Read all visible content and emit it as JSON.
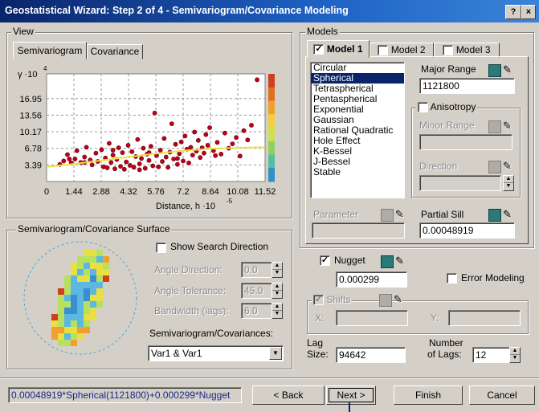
{
  "window": {
    "title": "Geostatistical Wizard: Step 2 of 4 - Semivariogram/Covariance Modeling",
    "help_label": "?",
    "close_label": "×"
  },
  "view": {
    "group_label": "View",
    "tabs": [
      "Semivariogram",
      "Covariance"
    ],
    "active_tab": "Semivariogram",
    "chart_data": {
      "type": "scatter",
      "ylabel": "γ ·10",
      "ylabel_exp": "4",
      "xlabel": "Distance, h ·10",
      "xlabel_exp": "-5",
      "ylim": [
        0,
        22
      ],
      "xlim": [
        0,
        11.52
      ],
      "yticks": [
        "3.39",
        "6.78",
        "10.17",
        "13.56",
        "16.95"
      ],
      "ytick_values": [
        3.39,
        6.78,
        10.17,
        13.56,
        16.95
      ],
      "xticks": [
        "0",
        "1.44",
        "2.88",
        "4.32",
        "5.76",
        "7.2",
        "8.64",
        "10.08",
        "11.52"
      ],
      "xtick_values": [
        0,
        1.44,
        2.88,
        4.32,
        5.76,
        7.2,
        8.64,
        10.08,
        11.52
      ],
      "grid": true,
      "fit_line": {
        "x": [
          0,
          1.44,
          2.88,
          4.32,
          5.76,
          7.2,
          8.64,
          10.08,
          11.52
        ],
        "y": [
          3.0,
          3.6,
          4.3,
          5.0,
          5.7,
          6.3,
          6.7,
          6.9,
          7.0
        ]
      },
      "points": [
        [
          0.7,
          3.5
        ],
        [
          0.9,
          4.2
        ],
        [
          1.1,
          5.5
        ],
        [
          1.3,
          3.8
        ],
        [
          1.5,
          4.6
        ],
        [
          1.6,
          6.3
        ],
        [
          1.8,
          3.9
        ],
        [
          2.0,
          5.0
        ],
        [
          2.1,
          7.0
        ],
        [
          2.3,
          4.4
        ],
        [
          2.4,
          3.4
        ],
        [
          2.6,
          5.8
        ],
        [
          2.7,
          4.1
        ],
        [
          2.9,
          6.5
        ],
        [
          3.0,
          3.0
        ],
        [
          3.1,
          4.8
        ],
        [
          3.2,
          2.8
        ],
        [
          3.3,
          7.8
        ],
        [
          3.4,
          3.9
        ],
        [
          3.5,
          5.4
        ],
        [
          3.6,
          2.6
        ],
        [
          3.7,
          4.5
        ],
        [
          3.8,
          6.9
        ],
        [
          3.9,
          3.1
        ],
        [
          4.0,
          5.9
        ],
        [
          4.1,
          2.5
        ],
        [
          4.2,
          4.0
        ],
        [
          4.3,
          7.4
        ],
        [
          4.4,
          3.3
        ],
        [
          4.5,
          6.1
        ],
        [
          4.6,
          2.9
        ],
        [
          4.7,
          5.1
        ],
        [
          4.8,
          8.6
        ],
        [
          4.9,
          3.6
        ],
        [
          5.0,
          4.7
        ],
        [
          5.1,
          6.8
        ],
        [
          5.2,
          2.7
        ],
        [
          5.3,
          5.6
        ],
        [
          5.4,
          4.3
        ],
        [
          5.5,
          7.2
        ],
        [
          5.6,
          3.2
        ],
        [
          5.7,
          14.0
        ],
        [
          5.8,
          5.3
        ],
        [
          5.9,
          3.0
        ],
        [
          6.0,
          6.4
        ],
        [
          6.1,
          4.1
        ],
        [
          6.2,
          8.8
        ],
        [
          6.3,
          5.0
        ],
        [
          6.4,
          2.9
        ],
        [
          6.5,
          6.0
        ],
        [
          6.6,
          11.8
        ],
        [
          6.7,
          4.6
        ],
        [
          6.8,
          7.6
        ],
        [
          6.9,
          3.5
        ],
        [
          7.0,
          5.7
        ],
        [
          7.1,
          8.1
        ],
        [
          7.2,
          4.2
        ],
        [
          7.3,
          9.3
        ],
        [
          7.4,
          6.6
        ],
        [
          7.5,
          3.8
        ],
        [
          7.6,
          7.0
        ],
        [
          7.7,
          5.4
        ],
        [
          7.8,
          10.1
        ],
        [
          7.9,
          6.2
        ],
        [
          8.0,
          8.4
        ],
        [
          8.1,
          4.9
        ],
        [
          8.2,
          6.9
        ],
        [
          8.3,
          5.8
        ],
        [
          8.4,
          9.6
        ],
        [
          8.5,
          7.4
        ],
        [
          8.6,
          11.0
        ],
        [
          8.8,
          6.3
        ],
        [
          9.0,
          8.0
        ],
        [
          9.2,
          5.6
        ],
        [
          9.4,
          9.9
        ],
        [
          9.6,
          6.8
        ],
        [
          9.8,
          7.7
        ],
        [
          10.0,
          9.0
        ],
        [
          10.2,
          5.2
        ],
        [
          10.4,
          10.4
        ],
        [
          10.6,
          8.5
        ],
        [
          10.8,
          11.5
        ],
        [
          11.1,
          20.8
        ],
        [
          2.0,
          3.9
        ],
        [
          4.9,
          2.4
        ],
        [
          6.9,
          4.7
        ],
        [
          3.5,
          6.4
        ],
        [
          8.9,
          5.3
        ],
        [
          1.2,
          4.6
        ],
        [
          5.4,
          5.9
        ]
      ],
      "colorbar": [
        "#d04020",
        "#e07020",
        "#f0a030",
        "#f0d040",
        "#d0e050",
        "#90d060",
        "#50c0a0",
        "#3090c8"
      ]
    }
  },
  "surface": {
    "group_label": "Semivariogram/Covariance Surface",
    "show_search_direction": "Show Search Direction",
    "angle_direction_label": "Angle Direction:",
    "angle_direction_value": "0.0",
    "angle_tolerance_label": "Angle Tolerance:",
    "angle_tolerance_value": "45.0",
    "bandwidth_label": "Bandwidth (lags):",
    "bandwidth_value": "6.0",
    "semi_cov_label": "Semivariogram/Covariances:",
    "semi_cov_value": "Var1 & Var1"
  },
  "models": {
    "group_label": "Models",
    "tabs": [
      "Model 1",
      "Model 2",
      "Model 3"
    ],
    "model_list": [
      "Circular",
      "Spherical",
      "Tetraspherical",
      "Pentaspherical",
      "Exponential",
      "Gaussian",
      "Rational Quadratic",
      "Hole Effect",
      "K-Bessel",
      "J-Bessel",
      "Stable"
    ],
    "selected_model": "Spherical",
    "major_range_label": "Major Range",
    "major_range_value": "1121800",
    "anisotropy_label": "Anisotropy",
    "minor_range_label": "Minor Range",
    "direction_label": "Direction",
    "parameter_label": "Parameter",
    "partial_sill_label": "Partial Sill",
    "partial_sill_value": "0.00048919",
    "check_mark": "✓",
    "pencil_icon": "✎"
  },
  "nugget": {
    "label": "Nugget",
    "value": "0.000299",
    "error_modeling_label": "Error Modeling",
    "shifts_label": "Shifts",
    "x_label": "X:",
    "y_label": "Y:"
  },
  "lag": {
    "lag_size_label_1": "Lag",
    "lag_size_label_2": "Size:",
    "lag_size_value": "94642",
    "num_lags_label_1": "Number",
    "num_lags_label_2": "of Lags:",
    "num_lags_value": "12"
  },
  "footer": {
    "formula": "0.00048919*Spherical(1121800)+0.000299*Nugget",
    "back": "< Back",
    "next": "Next >",
    "finish": "Finish",
    "cancel": "Cancel"
  }
}
